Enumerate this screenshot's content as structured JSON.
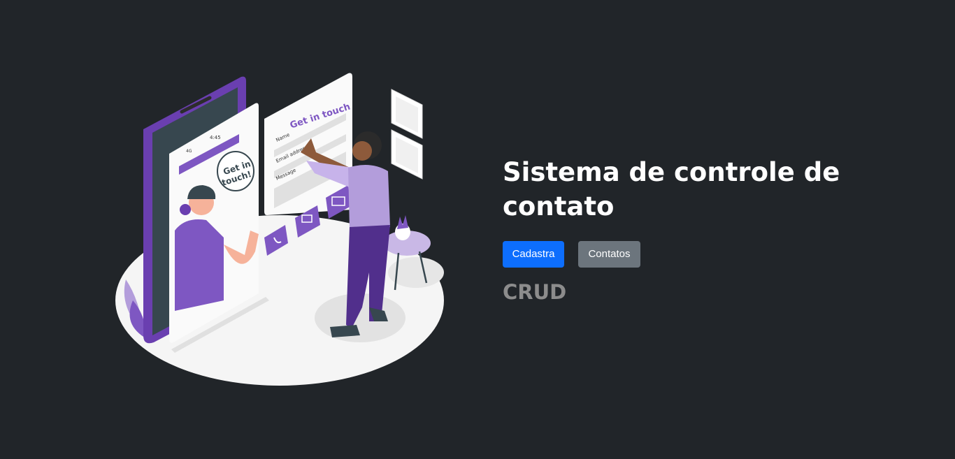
{
  "hero": {
    "title": "Sistema de controle de contato",
    "subtitle": "CRUD"
  },
  "buttons": {
    "primary_label": "Cadastra",
    "secondary_label": "Contatos"
  },
  "illustration": {
    "phone_time": "4:45",
    "phone_signal": "4G",
    "bubble_text_line1": "Get in",
    "bubble_text_line2": "touch!",
    "form_title": "Get in touch",
    "form_field_name": "Name",
    "form_field_email": "Email address",
    "form_field_message": "Message"
  },
  "colors": {
    "background": "#212529",
    "primary": "#0d6efd",
    "secondary": "#6c757d",
    "accent_purple": "#7e57c2"
  }
}
